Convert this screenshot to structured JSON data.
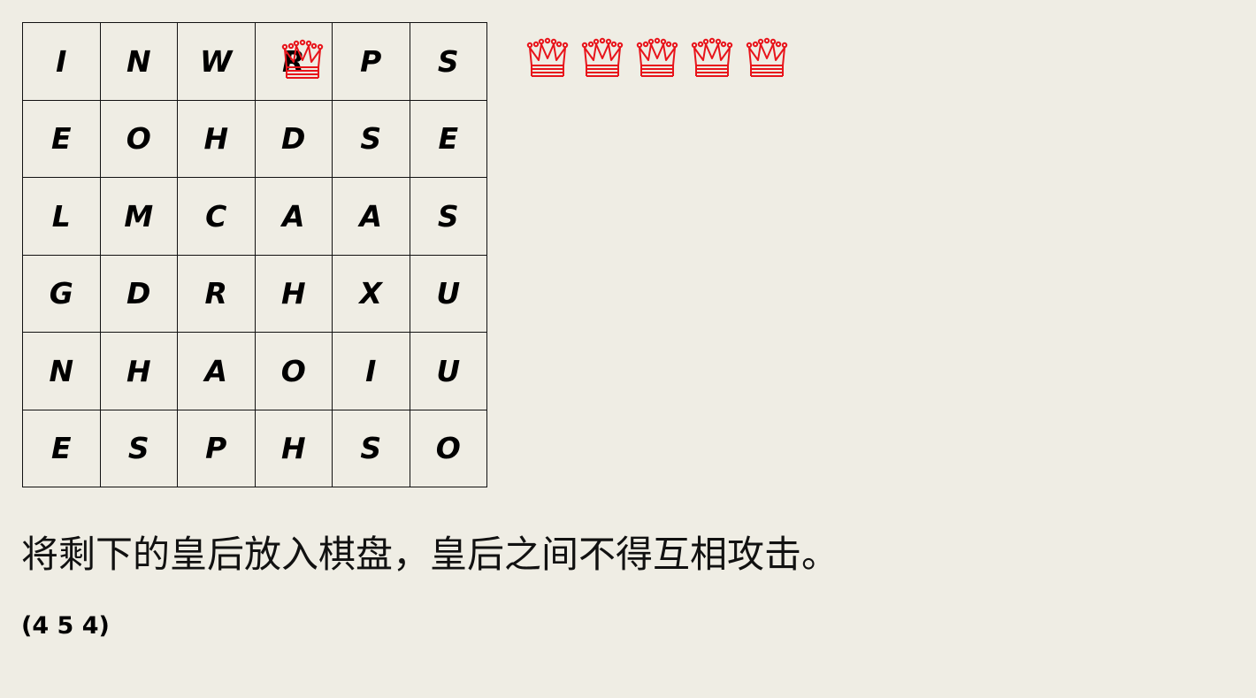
{
  "board": {
    "rows": [
      [
        "I",
        "N",
        "W",
        "R",
        "P",
        "S"
      ],
      [
        "E",
        "O",
        "H",
        "D",
        "S",
        "E"
      ],
      [
        "L",
        "M",
        "C",
        "A",
        "A",
        "S"
      ],
      [
        "G",
        "D",
        "R",
        "H",
        "X",
        "U"
      ],
      [
        "N",
        "H",
        "A",
        "O",
        "I",
        "U"
      ],
      [
        "E",
        "S",
        "P",
        "H",
        "S",
        "O"
      ]
    ],
    "placed_queens": [
      {
        "row": 0,
        "col": 3
      }
    ]
  },
  "tray": {
    "remaining_queens": 5,
    "queen_icon": "queen-crown-icon",
    "queen_color": "#e8141b"
  },
  "instruction": "将剩下的皇后放入棋盘，皇后之间不得互相攻击。",
  "code": "(4 5 4)"
}
